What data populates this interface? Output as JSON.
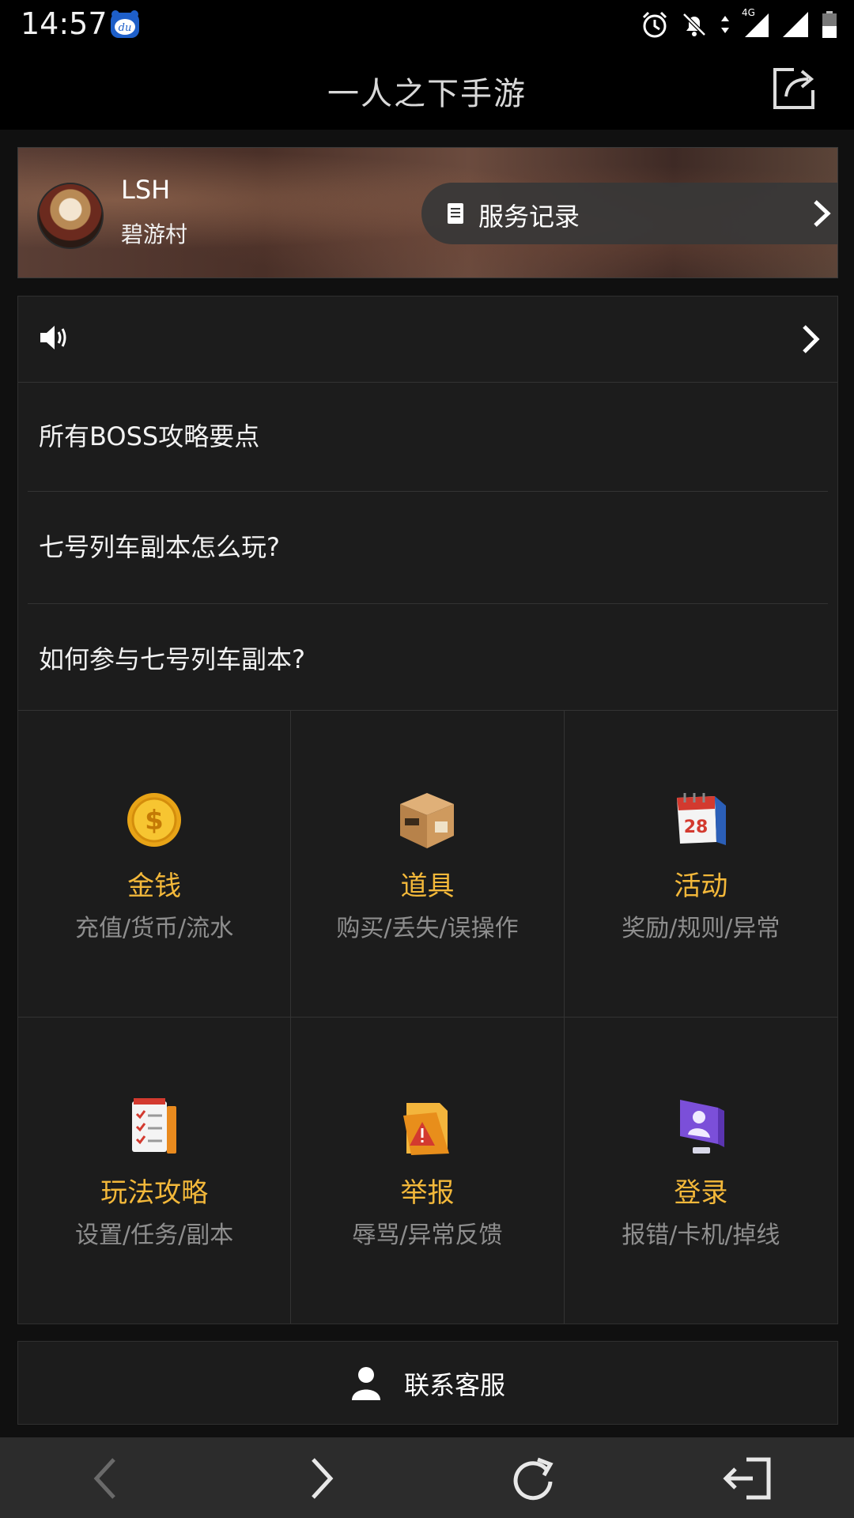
{
  "status_bar": {
    "time": "14:57",
    "network": "4G",
    "icons": [
      "alarm-icon",
      "bell-off-icon",
      "data-arrows-icon",
      "signal-icon",
      "signal-icon",
      "battery-icon"
    ]
  },
  "header": {
    "title": "一人之下手游",
    "share_icon": "share-icon"
  },
  "banner": {
    "user_name": "LSH",
    "server": "碧游村",
    "service_record_label": "服务记录"
  },
  "notice": {
    "icon": "speaker-icon",
    "text": ""
  },
  "faq": [
    "所有BOSS攻略要点",
    "七号列车副本怎么玩?",
    "如何参与七号列车副本?"
  ],
  "categories": [
    {
      "title": "金钱",
      "subtitle": "充值/货币/流水",
      "icon": "gold-coin-icon"
    },
    {
      "title": "道具",
      "subtitle": "购买/丢失/误操作",
      "icon": "box-icon"
    },
    {
      "title": "活动",
      "subtitle": "奖励/规则/异常",
      "icon": "calendar-icon"
    },
    {
      "title": "玩法攻略",
      "subtitle": "设置/任务/副本",
      "icon": "checklist-book-icon"
    },
    {
      "title": "举报",
      "subtitle": "辱骂/异常反馈",
      "icon": "warning-folder-icon"
    },
    {
      "title": "登录",
      "subtitle": "报错/卡机/掉线",
      "icon": "user-monitor-icon"
    }
  ],
  "contact": {
    "label": "联系客服",
    "icon": "person-icon"
  },
  "bottom_nav": [
    "back-icon",
    "forward-icon",
    "refresh-icon",
    "exit-icon"
  ],
  "colors": {
    "accent": "#f3b83a",
    "background": "#101010",
    "card": "#1c1c1c",
    "subtitle": "#8e8e8e"
  }
}
